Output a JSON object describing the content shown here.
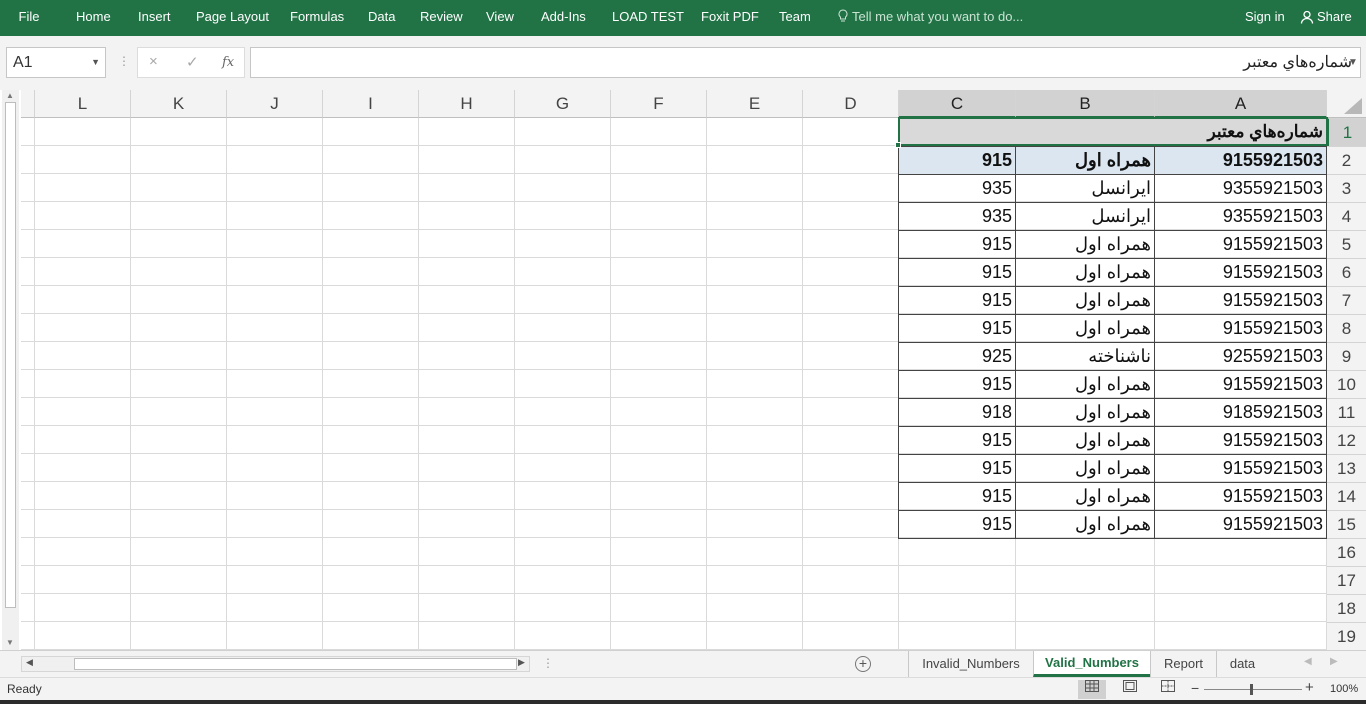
{
  "ribbon": {
    "tabs": [
      "File",
      "Home",
      "Insert",
      "Page Layout",
      "Formulas",
      "Data",
      "Review",
      "View",
      "Add-Ins",
      "LOAD TEST",
      "Foxit PDF",
      "Team"
    ],
    "tell_me": "Tell me what you want to do...",
    "sign_in": "Sign in",
    "share": "Share",
    "accent_color": "#217346"
  },
  "formula_bar": {
    "name_box": "A1",
    "cancel_icon": "×",
    "enter_icon": "✓",
    "fx_label": "fx",
    "content": "شماره‌هاي معتبر"
  },
  "columns": [
    "L",
    "K",
    "J",
    "I",
    "H",
    "G",
    "F",
    "E",
    "D",
    "C",
    "B",
    "A"
  ],
  "rows": [
    "1",
    "2",
    "3",
    "4",
    "5",
    "6",
    "7",
    "8",
    "9",
    "10",
    "11",
    "12",
    "13",
    "14",
    "15",
    "16",
    "17",
    "18",
    "19"
  ],
  "sheet": {
    "title": "شماره‌هاي معتبر",
    "data": [
      {
        "a": "9155921503",
        "b": "همراه اول",
        "c": "915"
      },
      {
        "a": "9355921503",
        "b": "ایرانسل",
        "c": "935"
      },
      {
        "a": "9355921503",
        "b": "ایرانسل",
        "c": "935"
      },
      {
        "a": "9155921503",
        "b": "همراه اول",
        "c": "915"
      },
      {
        "a": "9155921503",
        "b": "همراه اول",
        "c": "915"
      },
      {
        "a": "9155921503",
        "b": "همراه اول",
        "c": "915"
      },
      {
        "a": "9155921503",
        "b": "همراه اول",
        "c": "915"
      },
      {
        "a": "9255921503",
        "b": "ناشناخته",
        "c": "925"
      },
      {
        "a": "9155921503",
        "b": "همراه اول",
        "c": "915"
      },
      {
        "a": "9185921503",
        "b": "همراه اول",
        "c": "918"
      },
      {
        "a": "9155921503",
        "b": "همراه اول",
        "c": "915"
      },
      {
        "a": "9155921503",
        "b": "همراه اول",
        "c": "915"
      },
      {
        "a": "9155921503",
        "b": "همراه اول",
        "c": "915"
      },
      {
        "a": "9155921503",
        "b": "همراه اول",
        "c": "915"
      }
    ]
  },
  "sheet_tabs": [
    "Invalid_Numbers",
    "Valid_Numbers",
    "Report",
    "data"
  ],
  "active_sheet": "Valid_Numbers",
  "status": {
    "ready": "Ready",
    "zoom": "100%"
  }
}
